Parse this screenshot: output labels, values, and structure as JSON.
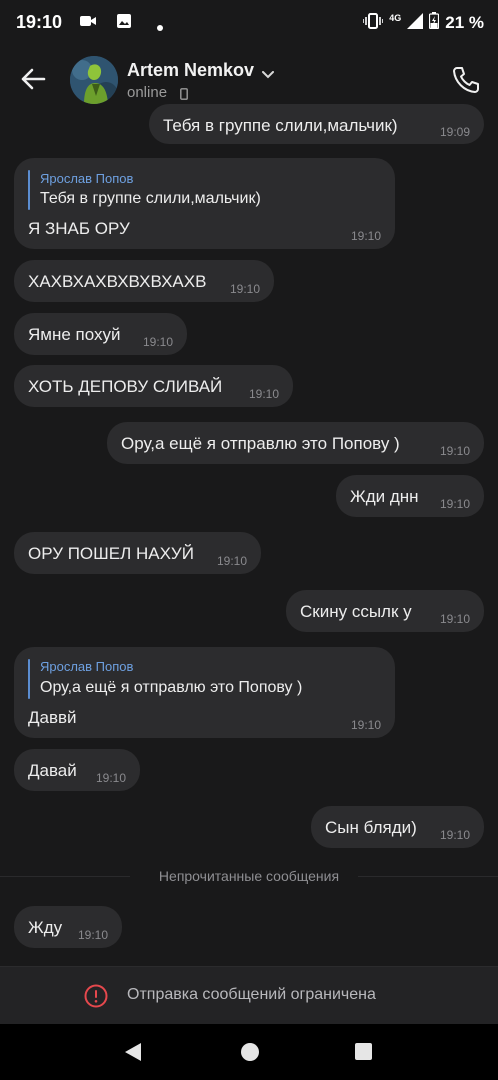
{
  "status_bar": {
    "time": "19:10",
    "network": "4G",
    "battery": "21 %"
  },
  "header": {
    "contact_name": "Artem Nemkov",
    "status": "online"
  },
  "messages": [
    {
      "id": "m0",
      "side": "out",
      "text": "Тебя в группе слили,мальчик)",
      "time": "19:09"
    },
    {
      "id": "m1",
      "side": "in",
      "reply_name": "Ярослав Попов",
      "reply_text": "Тебя в группе слили,мальчик)",
      "text": "Я ЗНАБ ОРУ",
      "time": "19:10"
    },
    {
      "id": "m2",
      "side": "in",
      "text": "ХАХВХАХВХВХВХАХВ",
      "time": "19:10"
    },
    {
      "id": "m3",
      "side": "in",
      "text": "Ямне похуй",
      "time": "19:10"
    },
    {
      "id": "m4",
      "side": "in",
      "text": "ХОТЬ ДЕПОВУ СЛИВАЙ",
      "time": "19:10"
    },
    {
      "id": "m5",
      "side": "out",
      "text": "Ору,а ещё я отправлю это Попову )",
      "time": "19:10"
    },
    {
      "id": "m6",
      "side": "out",
      "text": "Жди днн",
      "time": "19:10"
    },
    {
      "id": "m7",
      "side": "in",
      "text": "ОРУ ПОШЕЛ НАХУЙ",
      "time": "19:10"
    },
    {
      "id": "m8",
      "side": "out",
      "text": "Скину ссылк у",
      "time": "19:10"
    },
    {
      "id": "m9",
      "side": "in",
      "reply_name": "Ярослав Попов",
      "reply_text": "Ору,а ещё я отправлю это Попову )",
      "text": "Даввй",
      "time": "19:10"
    },
    {
      "id": "m10",
      "side": "in",
      "text": "Давай",
      "time": "19:10"
    },
    {
      "id": "m11",
      "side": "out",
      "text": "Сын бляди)",
      "time": "19:10"
    },
    {
      "id": "m12",
      "side": "in",
      "text": "Жду",
      "time": "19:10"
    }
  ],
  "unread_divider": "Непрочитанные сообщения",
  "restricted_notice": "Отправка сообщений ограничена",
  "colors": {
    "background": "#19191a",
    "bubble": "#2c2c2e",
    "reply_accent": "#5b8dd1",
    "warning": "#e5484d"
  },
  "icons": {
    "back": "arrow-left-icon",
    "call": "phone-icon",
    "device": "mobile-device-icon",
    "warning": "exclamation-circle-icon"
  }
}
